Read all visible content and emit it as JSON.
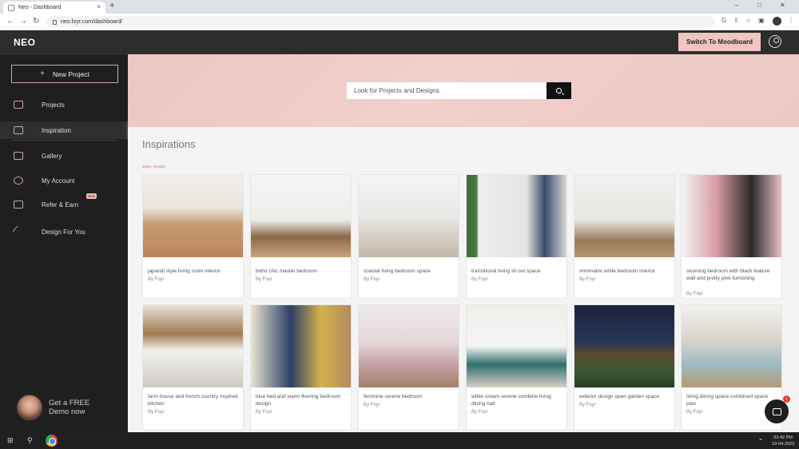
{
  "browser": {
    "tab_title": "Neo - Dashboard",
    "tab_close": "×",
    "new_tab": "+",
    "url": "neo.foyr.com/dashboard/",
    "window_controls": [
      "–",
      "□",
      "✕"
    ]
  },
  "header": {
    "logo": "NEO",
    "switch_button": "Switch To Moodboard"
  },
  "sidebar": {
    "new_project": "New Project",
    "items": [
      {
        "label": "Projects",
        "icon": "folder-icon"
      },
      {
        "label": "Inspiration",
        "icon": "book-icon",
        "active": true
      },
      {
        "label": "Gallery",
        "icon": "gallery-icon"
      },
      {
        "label": "My Account",
        "icon": "user-icon"
      },
      {
        "label": "Refer & Earn",
        "icon": "crown-icon",
        "badge": "New"
      },
      {
        "label": "Design For You",
        "icon": "magic-wand-icon"
      }
    ],
    "demo": {
      "line1": "Get a FREE",
      "line2": "Demo now"
    }
  },
  "search": {
    "placeholder": "Look for Projects and Designs"
  },
  "section": {
    "title": "Inspirations",
    "results": "6150+ Results"
  },
  "cards": [
    {
      "title": "japandi style living room interior",
      "author": "By Foyr"
    },
    {
      "title": "boho chic master bedroom",
      "author": "By Foyr"
    },
    {
      "title": "coastal living bedroom space",
      "author": "By Foyr"
    },
    {
      "title": "transitional living sit out space",
      "author": "By Foyr"
    },
    {
      "title": "minimalist white bedroom interior",
      "author": "By Foyr"
    },
    {
      "title": "stunning bedroom with black feature wall and pretty pink furnishing",
      "author": "By Foyr"
    },
    {
      "title": "farm house and french country inspired kitchen",
      "author": "By Foyr"
    },
    {
      "title": "blue bed and warm flooring bedroom design",
      "author": "By Foyr"
    },
    {
      "title": "feminine serene bedroom",
      "author": "By Foyr"
    },
    {
      "title": "white cream serene combine living dining hall",
      "author": "By Foyr"
    },
    {
      "title": "exterior design open garden space",
      "author": "By Foyr"
    },
    {
      "title": "living dining space combined space plan",
      "author": "By Foyr"
    }
  ],
  "chat": {
    "badge": "1"
  },
  "taskbar": {
    "time": "03:42 PM",
    "date": "19-04-2023"
  },
  "colors": {
    "accent_pink": "#efc6c2",
    "sidebar_bg": "#1f1f1f",
    "header_bg": "#2d2d2d"
  }
}
